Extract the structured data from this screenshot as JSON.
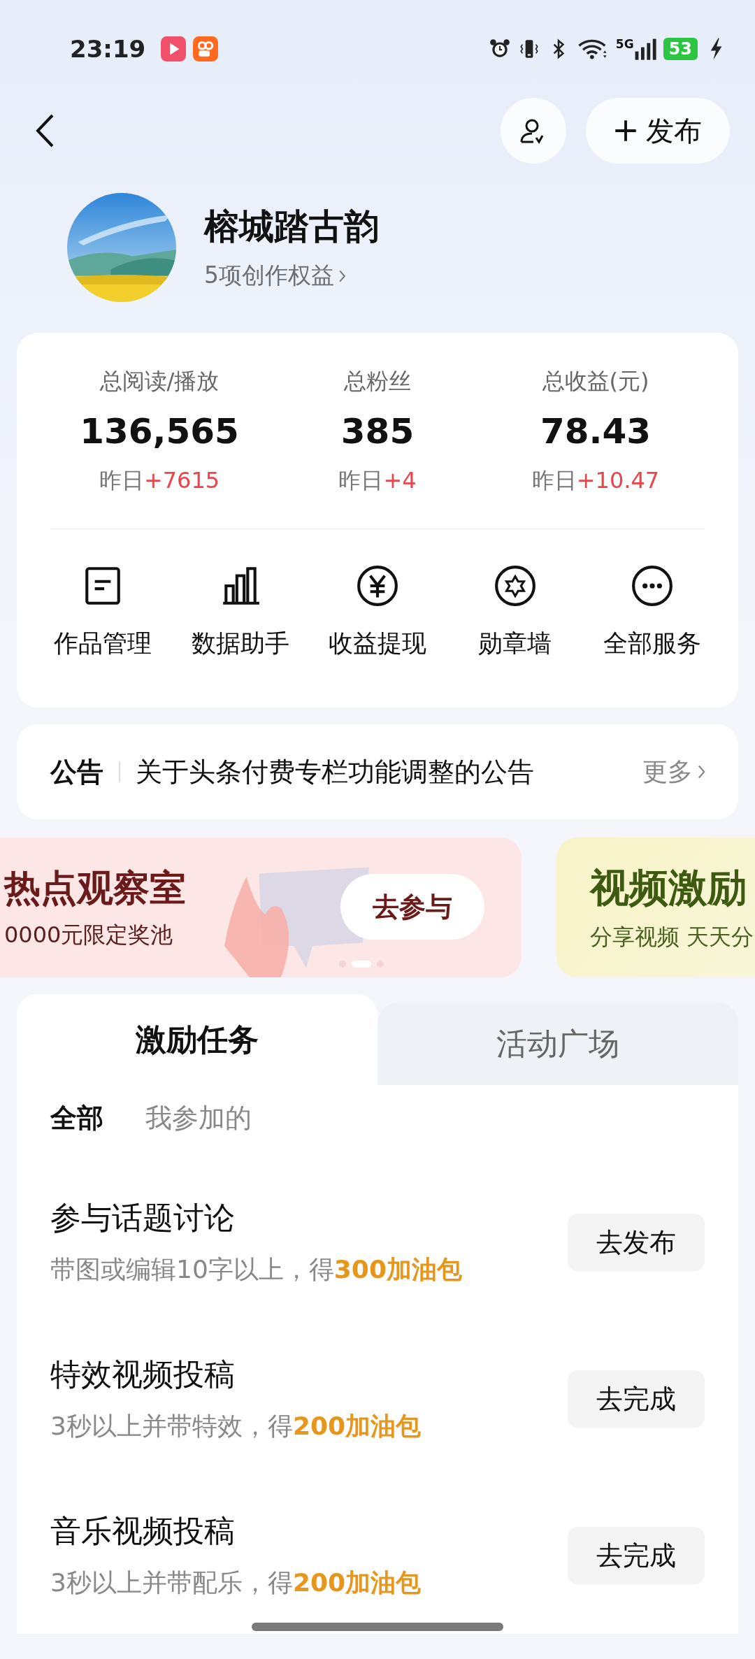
{
  "status_bar": {
    "time": "23:19",
    "network": "5G",
    "battery": "53"
  },
  "header": {
    "publish_label": "发布"
  },
  "profile": {
    "name": "榕城踏古韵",
    "benefits": "5项创作权益"
  },
  "stats": [
    {
      "label": "总阅读/播放",
      "value": "136,565",
      "yesterday": "昨日",
      "delta": "+7615"
    },
    {
      "label": "总粉丝",
      "value": "385",
      "yesterday": "昨日",
      "delta": "+4"
    },
    {
      "label": "总收益(元)",
      "value": "78.43",
      "yesterday": "昨日",
      "delta": "+10.47"
    }
  ],
  "services": [
    {
      "label": "作品管理",
      "kind": "document"
    },
    {
      "label": "数据助手",
      "kind": "chart"
    },
    {
      "label": "收益提现",
      "kind": "money"
    },
    {
      "label": "勋章墙",
      "kind": "medal"
    },
    {
      "label": "全部服务",
      "kind": "more"
    }
  ],
  "notice": {
    "label": "公告",
    "text": "关于头条付费专栏功能调整的公告",
    "more": "更多"
  },
  "banners": [
    {
      "kind": "hot",
      "title": "热点观察室",
      "subtitle": "0000元限定奖池",
      "button": "去参与"
    },
    {
      "kind": "video",
      "title": "视频激励",
      "subtitle": "分享视频 天天分"
    }
  ],
  "carousel_dots": [
    {
      "selected": false
    },
    {
      "selected": true
    },
    {
      "selected": false
    }
  ],
  "tabs": [
    {
      "label": "激励任务",
      "selected": true
    },
    {
      "label": "活动广场",
      "selected": false
    }
  ],
  "filters": [
    {
      "label": "全部",
      "selected": true
    },
    {
      "label": "我参加的",
      "selected": false
    }
  ],
  "tasks": [
    {
      "title": "参与话题讨论",
      "description": "带图或编辑10字以上，得",
      "reward": "300加油包",
      "button": "去发布"
    },
    {
      "title": "特效视频投稿",
      "description": "3秒以上并带特效，得",
      "reward": "200加油包",
      "button": "去完成"
    },
    {
      "title": "音乐视频投稿",
      "description": "3秒以上并带配乐，得",
      "reward": "200加油包",
      "button": "去完成"
    }
  ]
}
